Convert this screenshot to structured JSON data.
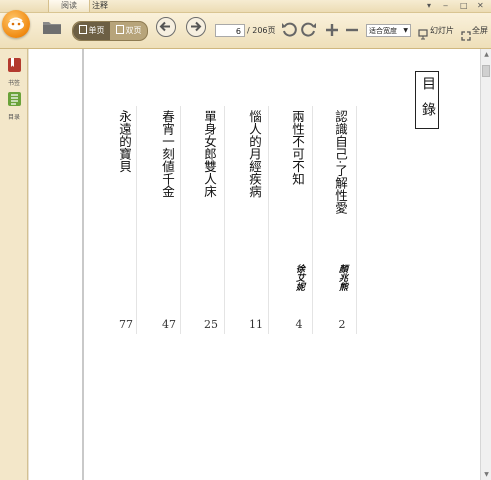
{
  "tabs": [
    {
      "label": "阅读"
    },
    {
      "label": "注释"
    }
  ],
  "window_controls": {
    "menu": "▾",
    "minimize": "‒",
    "restore": "□",
    "close": "✕"
  },
  "toolbar": {
    "view_single_label": "单页",
    "view_double_label": "双页",
    "current_page": "6",
    "total_pages": "/ 206页",
    "zoom_value": "适合宽度",
    "slideshow_label": "幻灯片",
    "fullscreen_label": "全屏"
  },
  "sidebar": {
    "items": [
      {
        "label": "书签",
        "icon": "bookmark-icon"
      },
      {
        "label": "目录",
        "icon": "toc-icon"
      }
    ]
  },
  "document": {
    "toc_title": "目錄",
    "entries": [
      {
        "title": "認識自己·了解性愛",
        "author": "顏兆熊",
        "page": "2"
      },
      {
        "title": "兩性不可不知",
        "author": "徐艾妮",
        "page": "4"
      },
      {
        "title": "惱人的月經疾病",
        "author": "",
        "page": "11"
      },
      {
        "title": "單身女郎雙人床",
        "author": "",
        "page": "25"
      },
      {
        "title": "春宵一刻値千金",
        "author": "",
        "page": "47"
      },
      {
        "title": "永遠的寶貝",
        "author": "",
        "page": "77"
      }
    ]
  },
  "colors": {
    "accent": "#f08a12",
    "toolbar_bg": "#f4e8c8",
    "sidebar_bookmark": "#b33a2e",
    "sidebar_toc": "#6aa23a"
  }
}
